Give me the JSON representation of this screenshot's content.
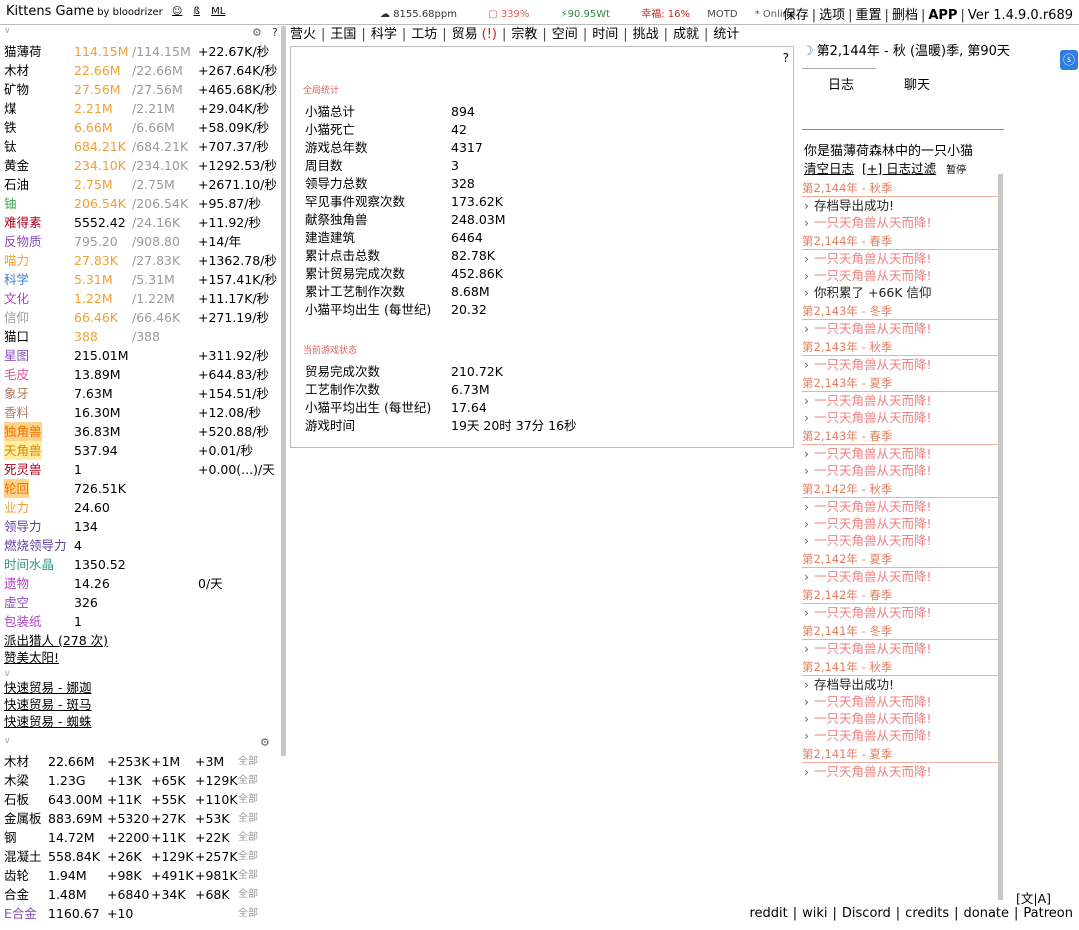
{
  "top": {
    "title": "Kittens Game",
    "by": "by bloodrizer",
    "links": [
      "☺",
      "ß",
      "ML"
    ],
    "stats": {
      "ppm": "8155.68ppm",
      "pct": "339%",
      "wt": "90.95Wt",
      "happiness": "幸福: 16%",
      "motd": "MOTD",
      "online": "* Online"
    },
    "menu": [
      "保存",
      "选项",
      "重置",
      "删档",
      "APP",
      "Ver 1.4.9.0.r689"
    ]
  },
  "colors": {
    "accent_orange": "#f0a030",
    "log_date": "#e08060",
    "unicorn_msg": "#f08080",
    "badge_blue": "#2e7de0"
  },
  "resources": [
    {
      "name": "猫薄荷",
      "value": "114.15M",
      "max": "/114.15M",
      "rate": "+22.67K/秒",
      "nc": "",
      "vc": "col-orange"
    },
    {
      "name": "木材",
      "value": "22.66M",
      "max": "/22.66M",
      "rate": "+267.64K/秒",
      "nc": "",
      "vc": "col-orange"
    },
    {
      "name": "矿物",
      "value": "27.56M",
      "max": "/27.56M",
      "rate": "+465.68K/秒",
      "nc": "",
      "vc": "col-orange"
    },
    {
      "name": "煤",
      "value": "2.21M",
      "max": "/2.21M",
      "rate": "+29.04K/秒",
      "nc": "",
      "vc": "col-orange"
    },
    {
      "name": "铁",
      "value": "6.66M",
      "max": "/6.66M",
      "rate": "+58.09K/秒",
      "nc": "",
      "vc": "col-orange"
    },
    {
      "name": "钛",
      "value": "684.21K",
      "max": "/684.21K",
      "rate": "+707.37/秒",
      "nc": "",
      "vc": "col-orange"
    },
    {
      "name": "黄金",
      "value": "234.10K",
      "max": "/234.10K",
      "rate": "+1292.53/秒",
      "nc": "",
      "vc": "col-orange"
    },
    {
      "name": "石油",
      "value": "2.75M",
      "max": "/2.75M",
      "rate": "+2671.10/秒",
      "nc": "",
      "vc": "col-orange"
    },
    {
      "name": "铀",
      "value": "206.54K",
      "max": "/206.54K",
      "rate": "+95.87/秒",
      "nc": "col-green",
      "vc": "col-orange"
    },
    {
      "name": "难得素",
      "value": "5552.42",
      "max": "/24.16K",
      "rate": "+11.92/秒",
      "nc": "col-darkred",
      "vc": ""
    },
    {
      "name": "反物质",
      "value": "795.20",
      "max": "/908.80",
      "rate": "+14/年",
      "nc": "col-purple",
      "vc": "col-gray"
    },
    {
      "name": "喵力",
      "value": "27.83K",
      "max": "/27.83K",
      "rate": "+1362.78/秒",
      "nc": "col-orange",
      "vc": "col-orange"
    },
    {
      "name": "科学",
      "value": "5.31M",
      "max": "/5.31M",
      "rate": "+157.41K/秒",
      "nc": "col-blue",
      "vc": "col-orange"
    },
    {
      "name": "文化",
      "value": "1.22M",
      "max": "/1.22M",
      "rate": "+11.17K/秒",
      "nc": "col-magenta",
      "vc": "col-orange"
    },
    {
      "name": "信仰",
      "value": "66.46K",
      "max": "/66.46K",
      "rate": "+271.19/秒",
      "nc": "col-gray",
      "vc": "col-orange"
    },
    {
      "name": "猫口",
      "value": "388",
      "max": "/388",
      "rate": "",
      "nc": "",
      "vc": "col-orange"
    },
    {
      "name": "星图",
      "value": "215.01M",
      "max": "",
      "rate": "+311.92/秒",
      "nc": "col-purple",
      "vc": ""
    },
    {
      "name": "毛皮",
      "value": "13.89M",
      "max": "",
      "rate": "+644.83/秒",
      "nc": "col-pink",
      "vc": ""
    },
    {
      "name": "象牙",
      "value": "7.63M",
      "max": "",
      "rate": "+154.51/秒",
      "nc": "col-brown",
      "vc": ""
    },
    {
      "name": "香料",
      "value": "16.30M",
      "max": "",
      "rate": "+12.08/秒",
      "nc": "col-brown",
      "vc": ""
    },
    {
      "name": "独角兽",
      "value": "36.83M",
      "max": "",
      "rate": "+520.88/秒",
      "nc": "col-hl-orange",
      "vc": ""
    },
    {
      "name": "天角兽",
      "value": "537.94",
      "max": "",
      "rate": "+0.01/秒",
      "nc": "col-hl-yellow",
      "vc": ""
    },
    {
      "name": "死灵兽",
      "value": "1",
      "max": "",
      "rate": "+0.00(...)/天",
      "nc": "col-darkred",
      "vc": ""
    },
    {
      "name": "轮回",
      "value": "726.51K",
      "max": "",
      "rate": "",
      "nc": "col-hl-orange",
      "vc": ""
    },
    {
      "name": "业力",
      "value": "24.60",
      "max": "",
      "rate": "",
      "nc": "col-orange",
      "vc": ""
    },
    {
      "name": "领导力",
      "value": "134",
      "max": "",
      "rate": "",
      "nc": "col-darkpurple",
      "vc": ""
    },
    {
      "name": "燃烧领导力",
      "value": "4",
      "max": "",
      "rate": "",
      "nc": "col-darkpurple",
      "vc": ""
    },
    {
      "name": "时间水晶",
      "value": "1350.52",
      "max": "",
      "rate": "",
      "nc": "col-teal",
      "vc": ""
    },
    {
      "name": "遗物",
      "value": "14.26",
      "max": "",
      "rate": "0/天",
      "nc": "col-magenta",
      "vc": ""
    },
    {
      "name": "虚空",
      "value": "326",
      "max": "",
      "rate": "",
      "nc": "col-purple",
      "vc": ""
    },
    {
      "name": "包装纸",
      "value": "1",
      "max": "",
      "rate": "",
      "nc": "col-magenta",
      "vc": ""
    }
  ],
  "left_links": {
    "hunt": "派出猎人 (278 次)",
    "praise": "赞美太阳!",
    "trades": [
      "快速贸易 - 娜迦",
      "快速贸易 - 斑马",
      "快速贸易 - 蜘蛛"
    ]
  },
  "craft": {
    "all_label": "全部",
    "rows": [
      {
        "name": "木材",
        "value": "22.66M",
        "c1": "+253K",
        "c2": "+1M",
        "c3": "+3M"
      },
      {
        "name": "木梁",
        "value": "1.23G",
        "c1": "+13K",
        "c2": "+65K",
        "c3": "+129K"
      },
      {
        "name": "石板",
        "value": "643.00M",
        "c1": "+11K",
        "c2": "+55K",
        "c3": "+110K"
      },
      {
        "name": "金属板",
        "value": "883.69M",
        "c1": "+5320",
        "c2": "+27K",
        "c3": "+53K"
      },
      {
        "name": "钢",
        "value": "14.72M",
        "c1": "+2200",
        "c2": "+11K",
        "c3": "+22K"
      },
      {
        "name": "混凝土",
        "value": "558.84K",
        "c1": "+26K",
        "c2": "+129K",
        "c3": "+257K"
      },
      {
        "name": "齿轮",
        "value": "1.94M",
        "c1": "+98K",
        "c2": "+491K",
        "c3": "+981K"
      },
      {
        "name": "合金",
        "value": "1.48M",
        "c1": "+6840",
        "c2": "+34K",
        "c3": "+68K"
      },
      {
        "name": "E合金",
        "value": "1160.67",
        "c1": "+10",
        "c2": "",
        "c3": ""
      }
    ]
  },
  "tabs": [
    "营火",
    "王国",
    "科学",
    "工坊",
    "贸易",
    "宗教",
    "空间",
    "时间",
    "挑战",
    "成就",
    "统计"
  ],
  "trade_warn": "(!)",
  "stats": {
    "help": "?",
    "global_head": "全局统计",
    "global": [
      {
        "label": "小猫总计",
        "value": "894"
      },
      {
        "label": "小猫死亡",
        "value": "42"
      },
      {
        "label": "游戏总年数",
        "value": "4317"
      },
      {
        "label": "周目数",
        "value": "3"
      },
      {
        "label": "领导力总数",
        "value": "328"
      },
      {
        "label": "罕见事件观察次数",
        "value": "173.62K"
      },
      {
        "label": "献祭独角兽",
        "value": "248.03M"
      },
      {
        "label": "建造建筑",
        "value": "6464"
      },
      {
        "label": "累计点击总数",
        "value": "82.78K"
      },
      {
        "label": "累计贸易完成次数",
        "value": "452.86K"
      },
      {
        "label": "累计工艺制作次数",
        "value": "8.68M"
      },
      {
        "label": "小猫平均出生 (每世纪)",
        "value": "20.32"
      }
    ],
    "current_head": "当前游戏状态",
    "current": [
      {
        "label": "贸易完成次数",
        "value": "210.72K"
      },
      {
        "label": "工艺制作次数",
        "value": "6.73M"
      },
      {
        "label": "小猫平均出生 (每世纪)",
        "value": "17.64"
      },
      {
        "label": "游戏时间",
        "value": "19天 20时 37分 16秒"
      }
    ]
  },
  "log": {
    "calendar": "第2,144年 - 秋 (温暖)季, 第90天",
    "tab_log": "日志",
    "tab_chat": "聊天",
    "intro": "你是猫薄荷森林中的一只小猫",
    "clear": "清空日志",
    "filter": "[+] 日志过滤",
    "pause": "暂停",
    "groups": [
      {
        "date": "第2,144年 - 秋季",
        "msgs": [
          {
            "t": "存档导出成功!",
            "k": "plain"
          },
          {
            "t": "一只天角兽从天而降!",
            "k": "unicorn"
          }
        ]
      },
      {
        "date": "第2,144年 - 春季",
        "msgs": [
          {
            "t": "一只天角兽从天而降!",
            "k": "unicorn"
          },
          {
            "t": "一只天角兽从天而降!",
            "k": "unicorn"
          },
          {
            "t": "你积累了 +66K 信仰",
            "k": "plain"
          }
        ]
      },
      {
        "date": "第2,143年 - 冬季",
        "msgs": [
          {
            "t": "一只天角兽从天而降!",
            "k": "unicorn"
          }
        ]
      },
      {
        "date": "第2,143年 - 秋季",
        "msgs": [
          {
            "t": "一只天角兽从天而降!",
            "k": "unicorn"
          }
        ]
      },
      {
        "date": "第2,143年 - 夏季",
        "msgs": [
          {
            "t": "一只天角兽从天而降!",
            "k": "unicorn"
          },
          {
            "t": "一只天角兽从天而降!",
            "k": "unicorn"
          }
        ]
      },
      {
        "date": "第2,143年 - 春季",
        "msgs": [
          {
            "t": "一只天角兽从天而降!",
            "k": "unicorn"
          },
          {
            "t": "一只天角兽从天而降!",
            "k": "unicorn"
          }
        ]
      },
      {
        "date": "第2,142年 - 秋季",
        "msgs": [
          {
            "t": "一只天角兽从天而降!",
            "k": "unicorn"
          },
          {
            "t": "一只天角兽从天而降!",
            "k": "unicorn"
          },
          {
            "t": "一只天角兽从天而降!",
            "k": "unicorn"
          }
        ]
      },
      {
        "date": "第2,142年 - 夏季",
        "msgs": [
          {
            "t": "一只天角兽从天而降!",
            "k": "unicorn"
          }
        ]
      },
      {
        "date": "第2,142年 - 春季",
        "msgs": [
          {
            "t": "一只天角兽从天而降!",
            "k": "unicorn"
          }
        ]
      },
      {
        "date": "第2,141年 - 冬季",
        "msgs": [
          {
            "t": "一只天角兽从天而降!",
            "k": "unicorn"
          }
        ]
      },
      {
        "date": "第2,141年 - 秋季",
        "msgs": [
          {
            "t": "存档导出成功!",
            "k": "plain"
          },
          {
            "t": "一只天角兽从天而降!",
            "k": "unicorn"
          },
          {
            "t": "一只天角兽从天而降!",
            "k": "unicorn"
          },
          {
            "t": "一只天角兽从天而降!",
            "k": "unicorn"
          }
        ]
      },
      {
        "date": "第2,141年 - 夏季",
        "msgs": [
          {
            "t": "一只天角兽从天而降!",
            "k": "unicorn"
          }
        ]
      }
    ]
  },
  "lang": "[文|A]",
  "footer": [
    "reddit",
    "wiki",
    "Discord",
    "credits",
    "donate",
    "Patreon"
  ]
}
